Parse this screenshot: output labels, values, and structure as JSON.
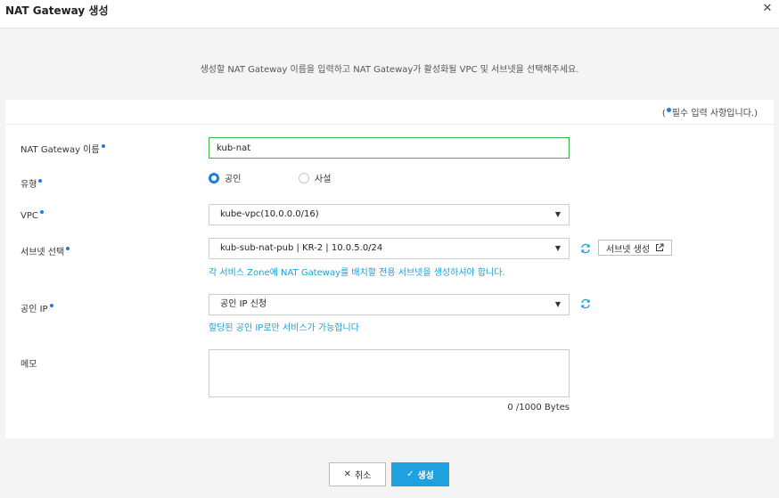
{
  "dialog": {
    "title": "NAT Gateway 생성",
    "close_icon": "close-icon",
    "description": "생성할 NAT Gateway 이름을 입력하고 NAT Gateway가 활성화될 VPC 및 서브넷을 선택해주세요."
  },
  "form": {
    "required_note_prefix": "(",
    "required_note_suffix": "필수 입력 사항입니다.)",
    "name": {
      "label": "NAT Gateway 이름",
      "value": "kub-nat"
    },
    "type": {
      "label": "유형",
      "options": [
        "공인",
        "사설"
      ],
      "selected": "공인"
    },
    "vpc": {
      "label": "VPC",
      "value": "kube-vpc(10.0.0.0/16)"
    },
    "subnet": {
      "label": "서브넷 선택",
      "value": "kub-sub-nat-pub | KR-2 | 10.0.5.0/24",
      "create_button": "서브넷 생성",
      "hint": "각 서비스 Zone에 NAT Gateway를 배치할 전용 서브넷을 생성하셔야 합니다."
    },
    "public_ip": {
      "label": "공인 IP",
      "value": "공인 IP 신청",
      "hint": "할당된 공인 IP로만 서비스가 가능합니다"
    },
    "memo": {
      "label": "메모",
      "value": "",
      "counter": "0 /1000 Bytes"
    }
  },
  "footer": {
    "cancel_label": "취소",
    "create_label": "생성"
  },
  "colors": {
    "accent": "#1a7de6",
    "primary_button": "#1ea1de",
    "hint": "#1aa0d6",
    "active_border": "#3ab24a"
  }
}
